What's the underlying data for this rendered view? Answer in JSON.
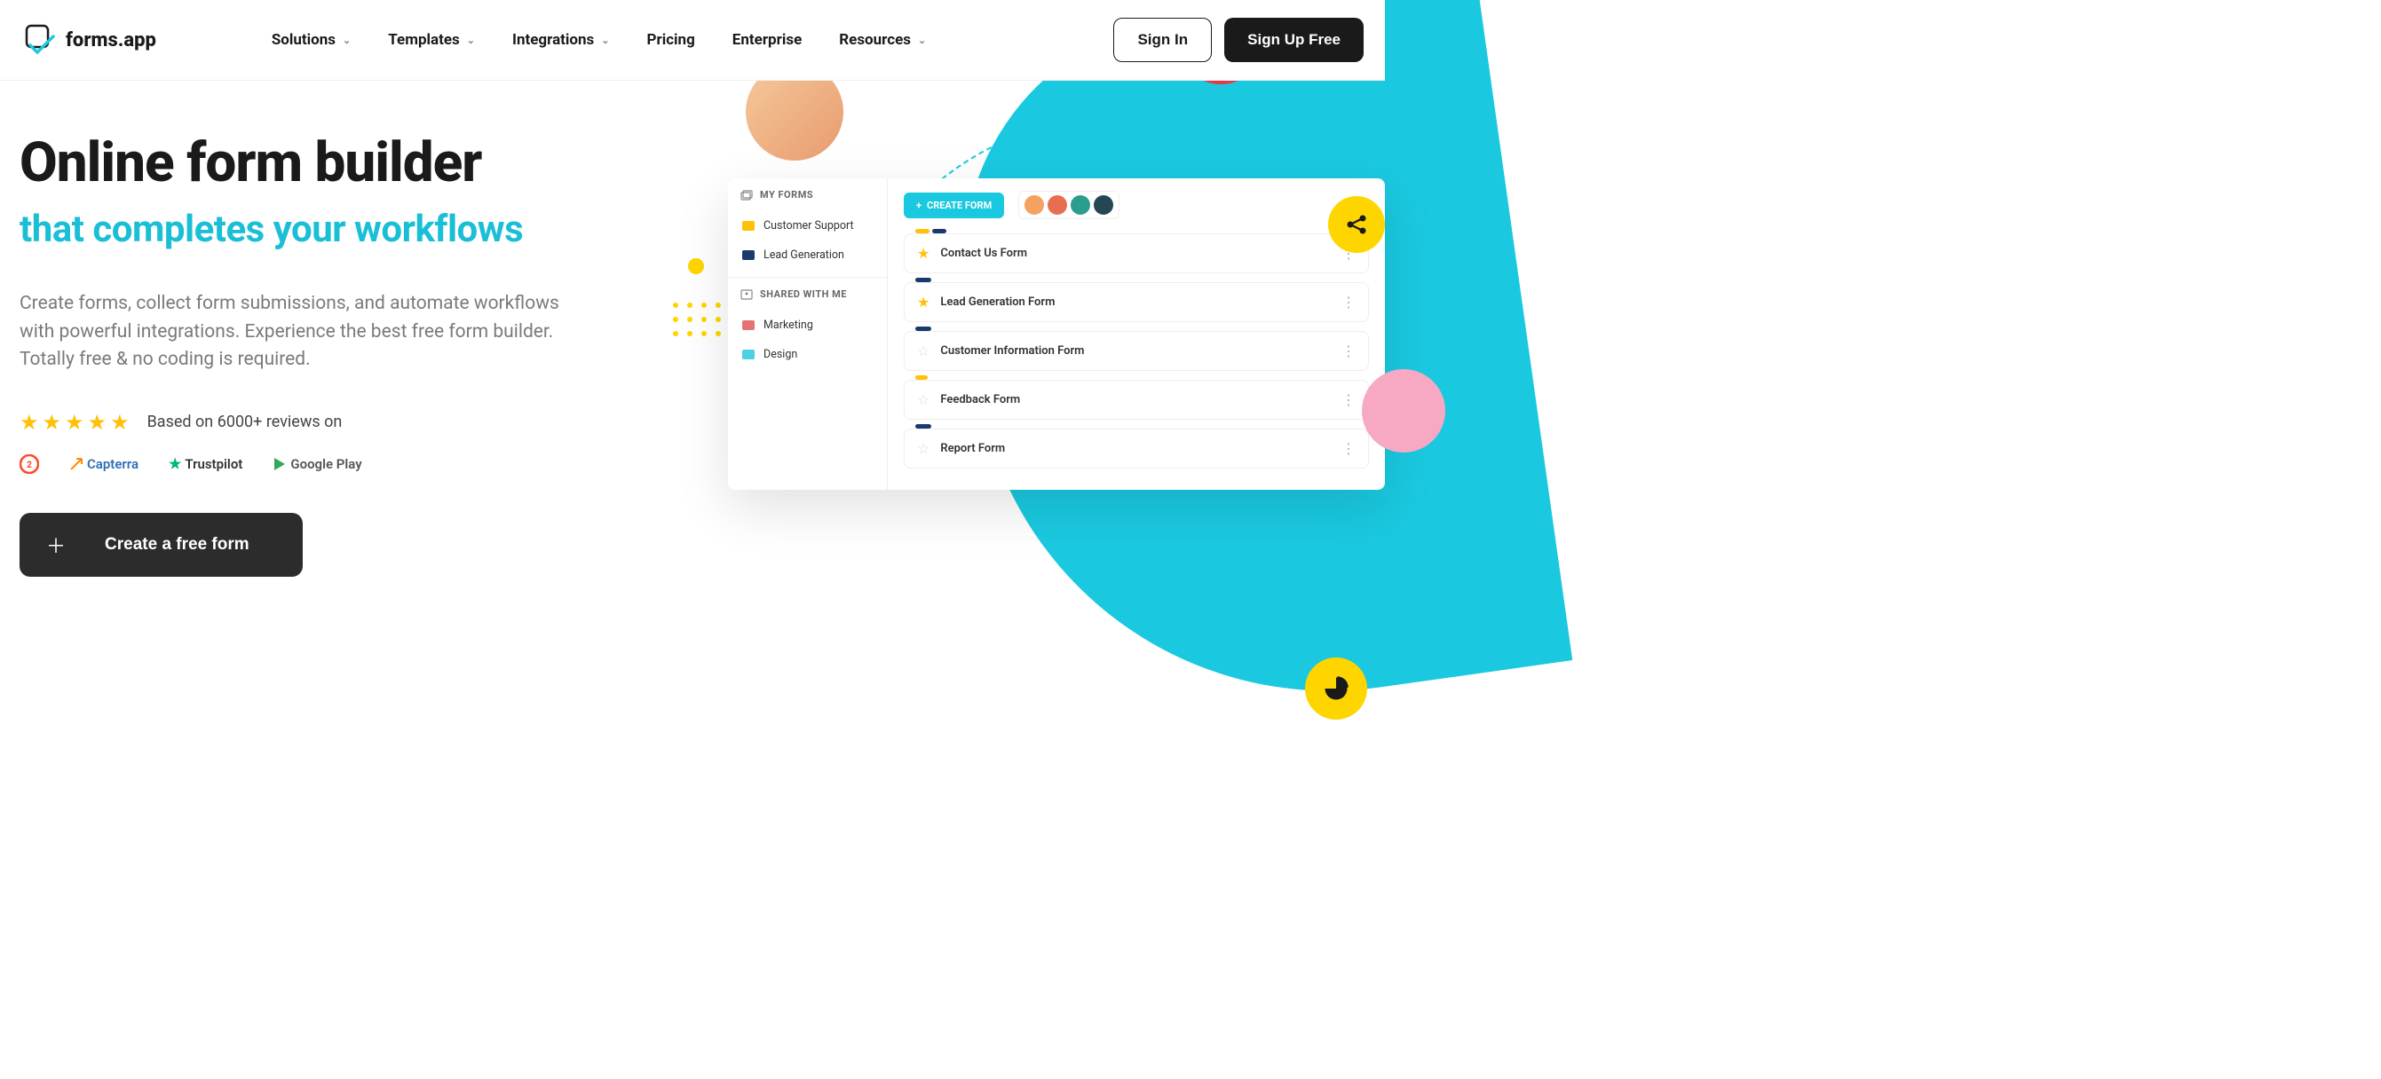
{
  "brand": "forms.app",
  "nav": {
    "items": [
      {
        "label": "Solutions",
        "hasDropdown": true
      },
      {
        "label": "Templates",
        "hasDropdown": true
      },
      {
        "label": "Integrations",
        "hasDropdown": true
      },
      {
        "label": "Pricing",
        "hasDropdown": false
      },
      {
        "label": "Enterprise",
        "hasDropdown": false
      },
      {
        "label": "Resources",
        "hasDropdown": true
      }
    ]
  },
  "header": {
    "signin": "Sign In",
    "signup": "Sign Up Free"
  },
  "hero": {
    "title": "Online form builder",
    "subtitle": "that completes your workflows",
    "description": "Create forms, collect form submissions, and automate workflows with powerful integrations. Experience the best free form builder. Totally free & no coding is required.",
    "rating_text": "Based on 6000+ reviews on",
    "review_sites": [
      "G2",
      "Capterra",
      "Trustpilot",
      "Google Play"
    ],
    "cta": "Create a free form"
  },
  "mockup": {
    "my_forms_header": "MY FORMS",
    "shared_header": "SHARED WITH ME",
    "folders_my": [
      "Customer Support",
      "Lead Generation"
    ],
    "folders_shared": [
      "Marketing",
      "Design"
    ],
    "create_button": "CREATE FORM",
    "forms": [
      {
        "name": "Contact Us Form",
        "starred": true
      },
      {
        "name": "Lead Generation Form",
        "starred": true
      },
      {
        "name": "Customer Information Form",
        "starred": false
      },
      {
        "name": "Feedback Form",
        "starred": false
      },
      {
        "name": "Report Form",
        "starred": false
      }
    ]
  }
}
